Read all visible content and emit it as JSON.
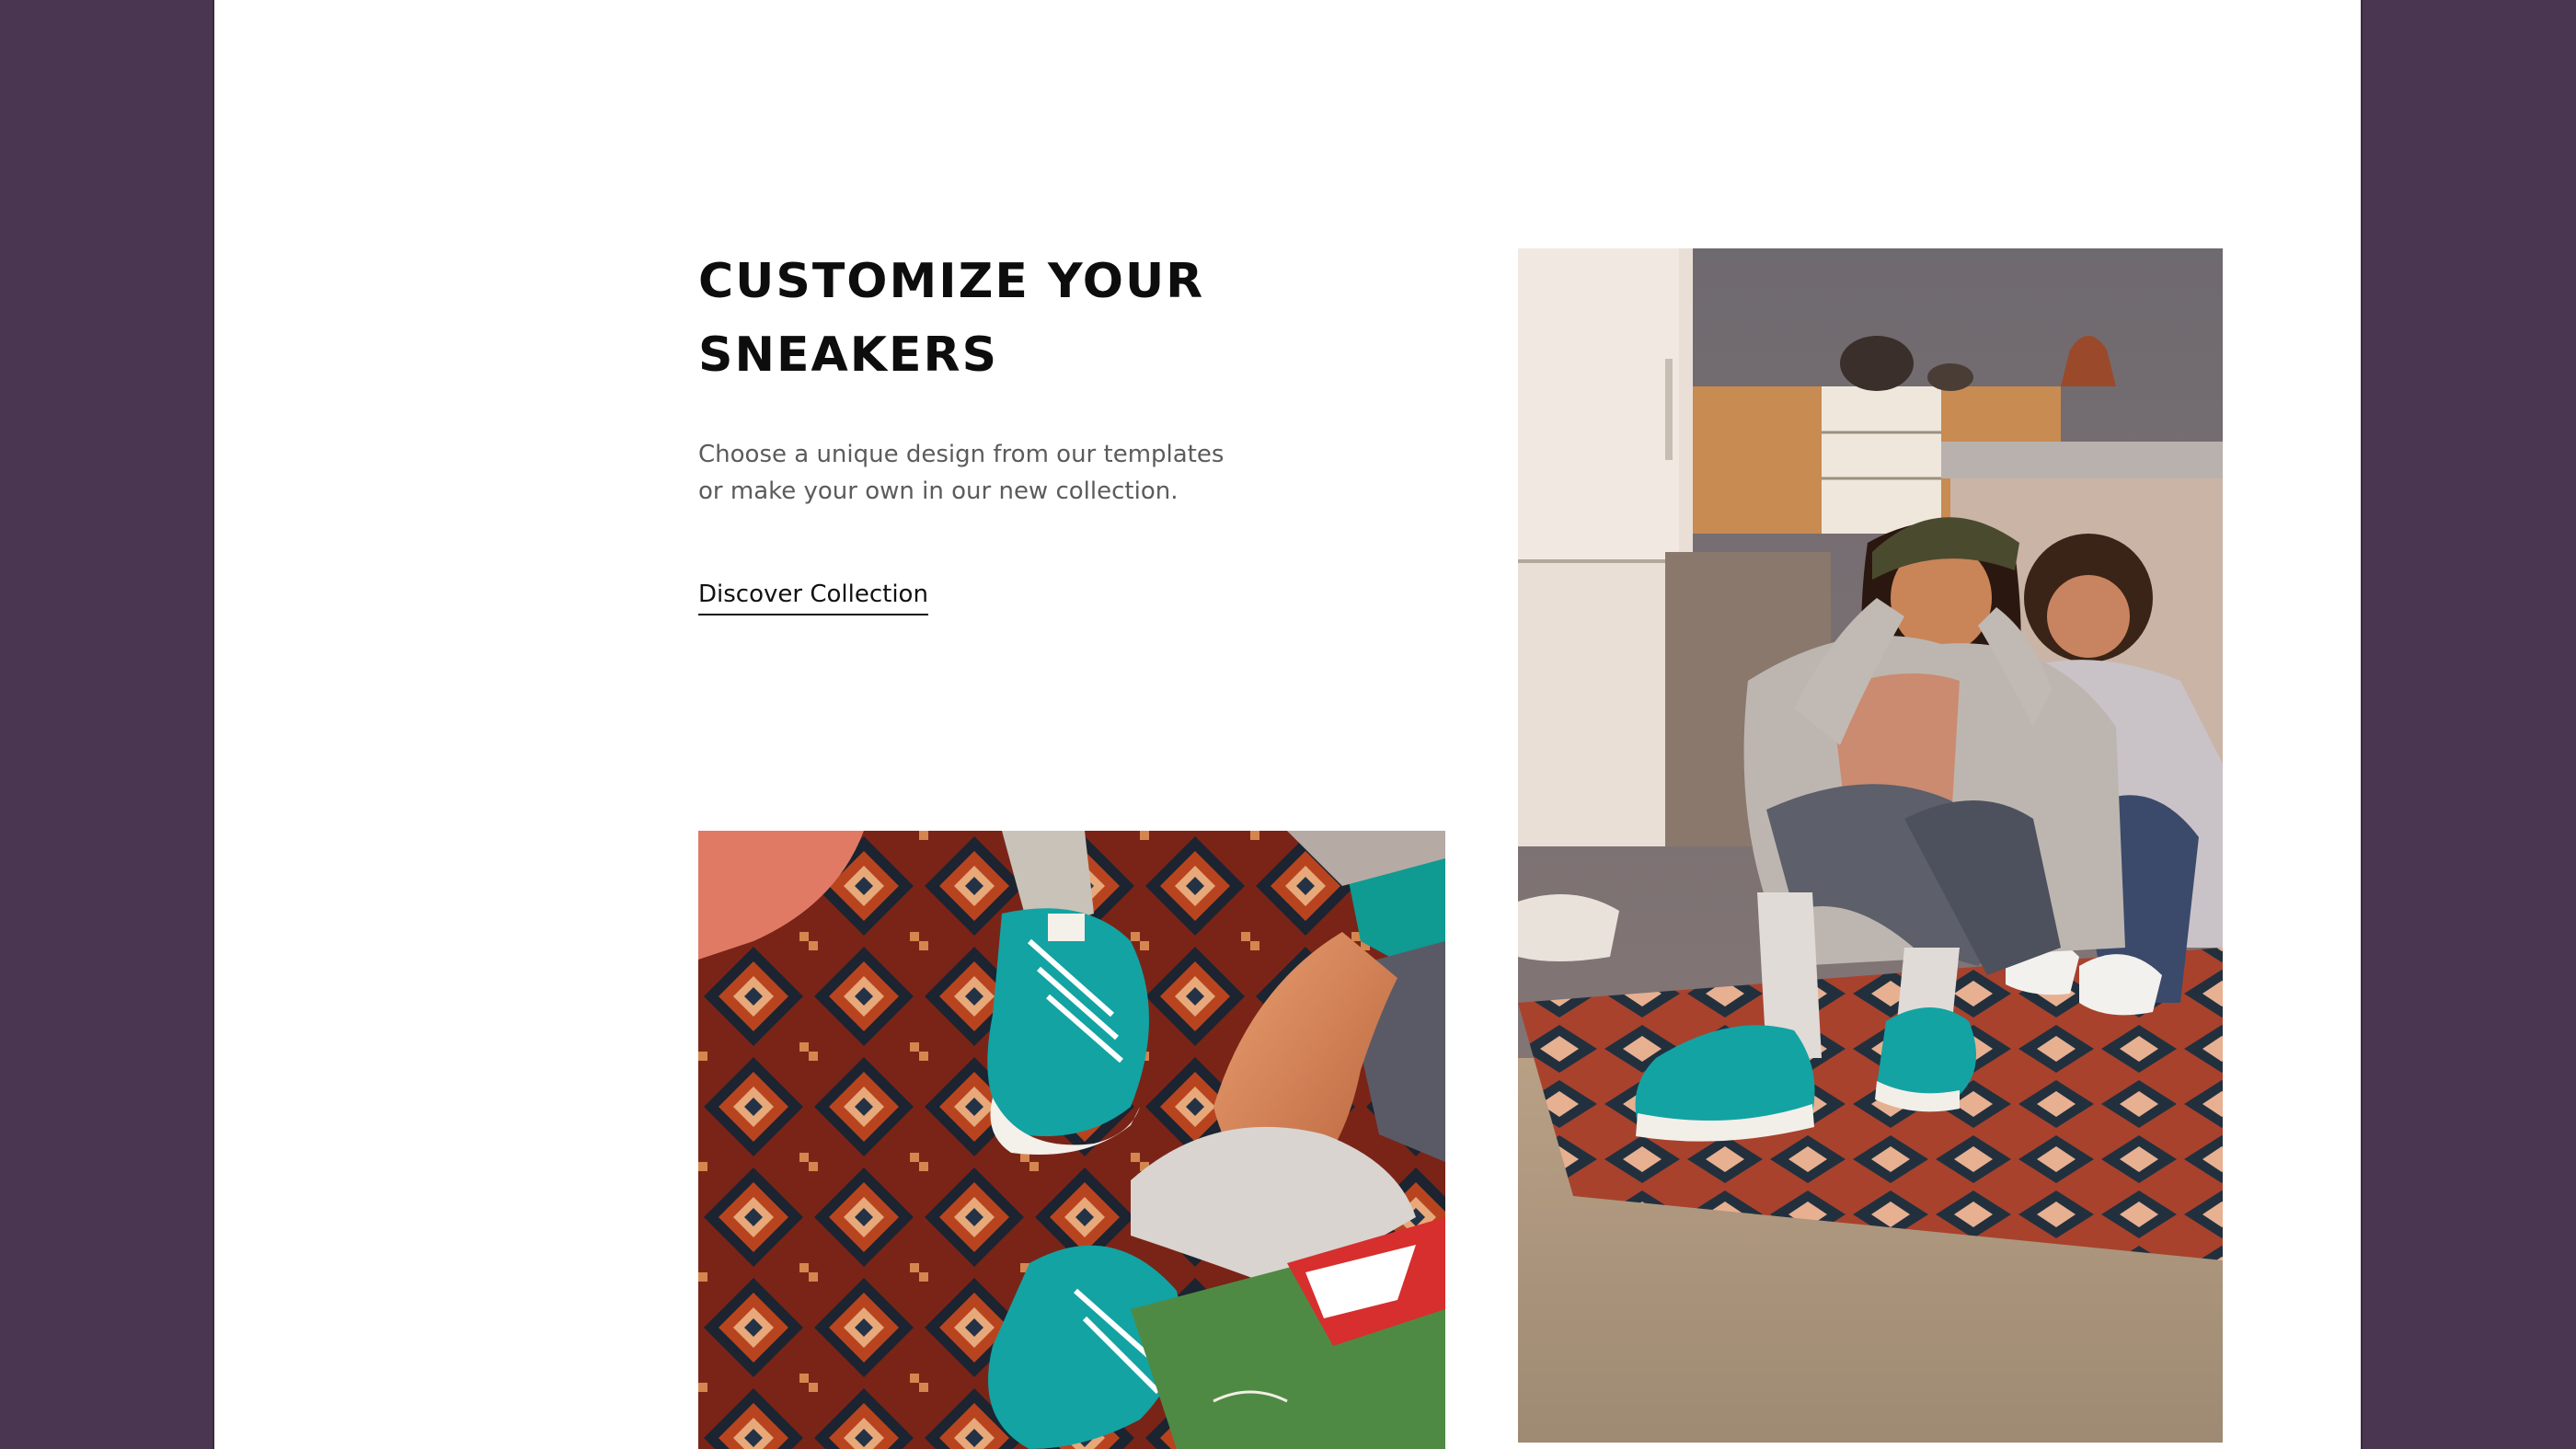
{
  "hero": {
    "title": "CUSTOMIZE YOUR SNEAKERS",
    "description": "Choose a unique design from our templates\nor make your own in our new collection.",
    "cta_label": "Discover Collection"
  },
  "colors": {
    "outer_background": "#4a3650",
    "page_background": "#ffffff",
    "title": "#0d0d0d",
    "body_text": "#5b5b5b",
    "sneaker_teal": "#13a3a3"
  },
  "images": [
    {
      "name": "sneakers-closeup-photo",
      "depicts": "teal canvas sneakers on a patterned rug"
    },
    {
      "name": "friends-kitchen-photo",
      "depicts": "two friends sitting on a rug in a kitchen wearing sneakers"
    }
  ]
}
